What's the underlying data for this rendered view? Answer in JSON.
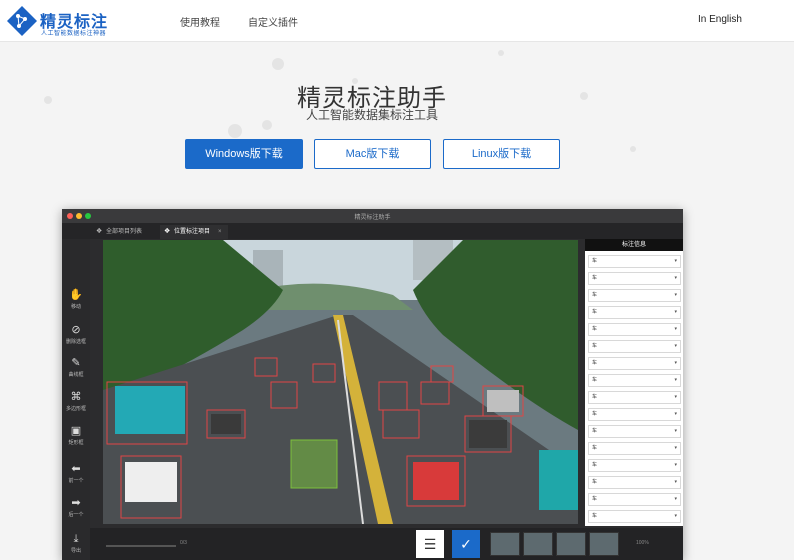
{
  "header": {
    "brand_name": "精灵标注",
    "brand_tagline": "人工智能数据标注神器",
    "nav": [
      "使用教程",
      "自定义插件"
    ],
    "lang_label": "In English"
  },
  "hero": {
    "title": "精灵标注助手",
    "subtitle": "人工智能数据集标注工具",
    "buttons": [
      "Windows版下载",
      "Mac版下载",
      "Linux版下载"
    ]
  },
  "app": {
    "window_title": "精灵标注助手",
    "tabs": [
      {
        "label": "全部项目列表",
        "icon": "grid-icon"
      },
      {
        "label": "位置标注项目",
        "icon": "grid-icon"
      }
    ],
    "tab_close": "×",
    "tools": [
      {
        "label": "移动",
        "glyph": "✋"
      },
      {
        "label": "删除选框",
        "glyph": "⊘"
      },
      {
        "label": "曲线框",
        "glyph": "✎"
      },
      {
        "label": "多边形框",
        "glyph": "⌘"
      },
      {
        "label": "矩形框",
        "glyph": "▣"
      },
      {
        "label": "前一个",
        "glyph": "⬅"
      },
      {
        "label": "后一个",
        "glyph": "➡"
      },
      {
        "label": "导出",
        "glyph": "⤓"
      }
    ],
    "panel_title": "标注信息",
    "label_rows": [
      "车",
      "车",
      "车",
      "车",
      "车",
      "车",
      "车",
      "车",
      "车",
      "车",
      "车",
      "车",
      "车",
      "车",
      "车",
      "车"
    ],
    "page_counter": "0/3",
    "zoom_level": "100%",
    "menu_glyph": "☰",
    "confirm_glyph": "✓"
  }
}
